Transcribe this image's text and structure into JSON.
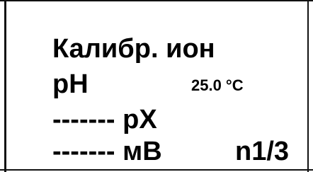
{
  "screen": {
    "title": "Калибр. ион",
    "ph_label": "pH",
    "temperature": "25.0 °C",
    "px_row": "------- pX",
    "mv_row": "------- мВ",
    "page_indicator": "n1/3"
  }
}
